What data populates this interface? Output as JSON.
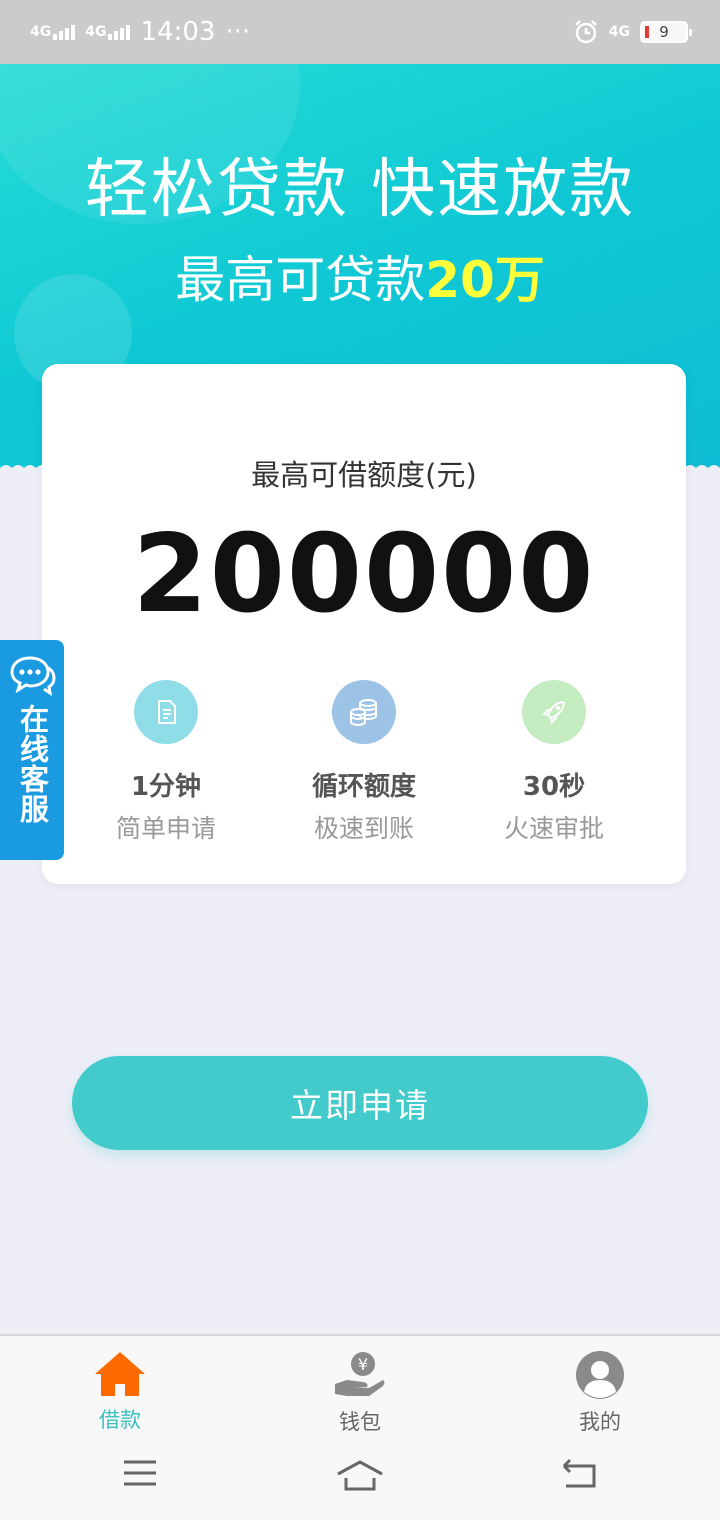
{
  "status_bar": {
    "signal1": "4G",
    "signal2": "4G",
    "time": "14:03",
    "more": "···",
    "network": "4G",
    "battery": "9"
  },
  "hero": {
    "title": "轻松贷款 快速放款",
    "subtitle_prefix": "最高可贷款",
    "subtitle_highlight": "20万"
  },
  "card": {
    "label": "最高可借额度(元)",
    "amount": "200000",
    "features": [
      {
        "title": "1分钟",
        "desc": "简单申请",
        "icon": "document-icon",
        "color": "#8fdde6"
      },
      {
        "title": "循环额度",
        "desc": "极速到账",
        "icon": "coins-icon",
        "color": "#9cc3e6"
      },
      {
        "title": "30秒",
        "desc": "火速审批",
        "icon": "rocket-icon",
        "color": "#c4ecc0"
      }
    ]
  },
  "service": {
    "label": "在线客服"
  },
  "apply_button": {
    "label": "立即申请"
  },
  "tabbar": {
    "items": [
      {
        "label": "借款",
        "icon": "home-icon",
        "active": true
      },
      {
        "label": "钱包",
        "icon": "wallet-icon",
        "active": false
      },
      {
        "label": "我的",
        "icon": "user-icon",
        "active": false
      }
    ]
  },
  "colors": {
    "accent": "#42cbca",
    "tab_active": "#ff6a00",
    "tab_active_label": "#3bbfc0",
    "service_blue": "#1a9ae0",
    "highlight_yellow": "#ffff3b"
  }
}
